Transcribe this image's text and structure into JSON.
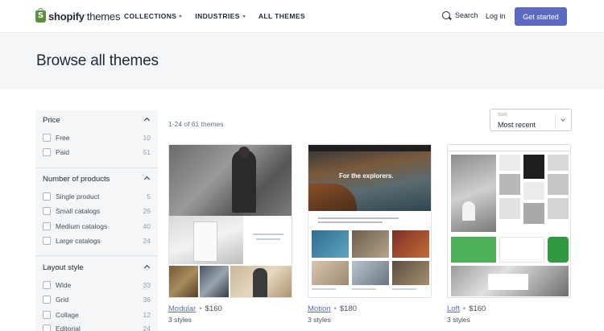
{
  "header": {
    "logo_word": "shopify",
    "logo_suffix": "themes",
    "nav": [
      {
        "label": "COLLECTIONS",
        "has_caret": true
      },
      {
        "label": "INDUSTRIES",
        "has_caret": true
      },
      {
        "label": "ALL THEMES",
        "has_caret": false
      }
    ],
    "search_label": "Search",
    "login_label": "Log in",
    "cta_label": "Get started",
    "cta_color": "#5c6ac4"
  },
  "hero": {
    "title": "Browse all themes"
  },
  "sidebar": {
    "price": {
      "title": "Price",
      "options": [
        {
          "label": "Free",
          "count": "10"
        },
        {
          "label": "Paid",
          "count": "51"
        }
      ]
    },
    "products": {
      "title": "Number of products",
      "options": [
        {
          "label": "Single product",
          "count": "5"
        },
        {
          "label": "Small catalogs",
          "count": "26"
        },
        {
          "label": "Medium catalogs",
          "count": "40"
        },
        {
          "label": "Large catalogs",
          "count": "24"
        }
      ]
    },
    "layout": {
      "title": "Layout style",
      "options": [
        {
          "label": "Wide",
          "count": "33"
        },
        {
          "label": "Grid",
          "count": "36"
        },
        {
          "label": "Collage",
          "count": "12"
        },
        {
          "label": "Editorial",
          "count": "24"
        }
      ]
    }
  },
  "results": {
    "count_text": "1-24 of 61 themes",
    "sort_label": "Sort",
    "sort_value": "Most recent"
  },
  "themes": [
    {
      "name": "Modular",
      "price": "$160",
      "styles": "3 styles"
    },
    {
      "name": "Motion",
      "price": "$180",
      "styles": "3 styles",
      "hero_text": "For the explorers."
    },
    {
      "name": "Loft",
      "price": "$160",
      "styles": "3 styles"
    }
  ]
}
